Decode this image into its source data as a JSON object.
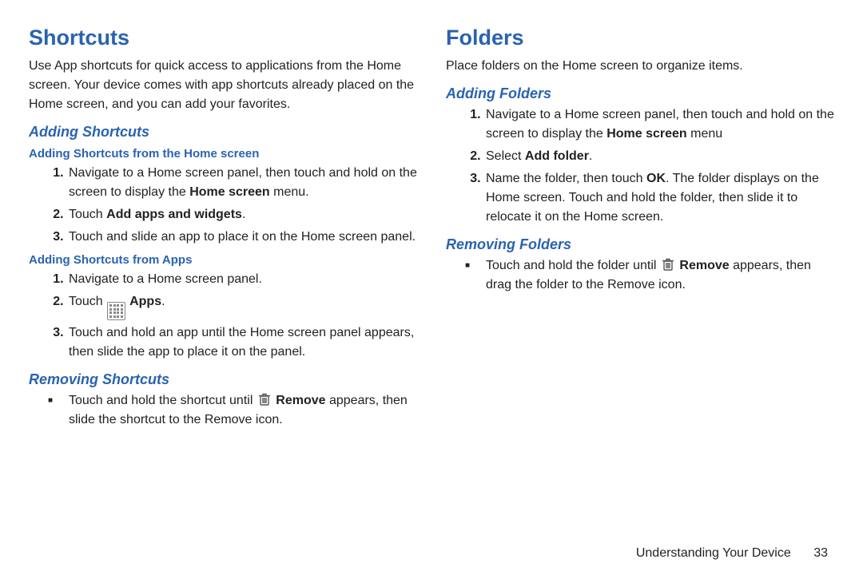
{
  "left": {
    "h1": "Shortcuts",
    "intro": "Use App shortcuts for quick access to applications from the Home screen. Your device comes with app shortcuts already placed on the Home screen, and you can add your favorites.",
    "adding_h2": "Adding Shortcuts",
    "home_h3": "Adding Shortcuts from the Home screen",
    "home_1a": "Navigate to a Home screen panel, then touch and hold on the screen to display the ",
    "home_1b": "Home screen",
    "home_1c": " menu.",
    "home_2a": "Touch ",
    "home_2b": "Add apps and widgets",
    "home_2c": ".",
    "home_3": "Touch and slide an app to place it on the Home screen panel.",
    "apps_h3": "Adding Shortcuts from Apps",
    "apps_1": "Navigate to a Home screen panel.",
    "apps_2a": "Touch ",
    "apps_2b": "Apps",
    "apps_2c": ".",
    "apps_3": "Touch and hold an app until the Home screen panel appears, then slide the app to place it on the panel.",
    "removing_h2": "Removing Shortcuts",
    "removing_a": "Touch and hold the shortcut until ",
    "removing_b": "Remove",
    "removing_c": " appears, then slide the shortcut to the Remove icon."
  },
  "right": {
    "h1": "Folders",
    "intro": "Place folders on the Home screen to organize items.",
    "adding_h2": "Adding Folders",
    "add_1a": "Navigate to a Home screen panel, then touch and hold on the screen to display the ",
    "add_1b": "Home screen",
    "add_1c": " menu",
    "add_2a": "Select ",
    "add_2b": "Add folder",
    "add_2c": ".",
    "add_3a": "Name the folder, then touch ",
    "add_3b": "OK",
    "add_3c": ". The folder displays on the Home screen. Touch and hold the folder, then slide it to relocate it on the Home screen.",
    "removing_h2": "Removing Folders",
    "removing_a": "Touch and hold the folder until ",
    "removing_b": "Remove",
    "removing_c": " appears, then drag the folder to the Remove icon."
  },
  "footer": {
    "section": "Understanding Your Device",
    "page": "33"
  }
}
